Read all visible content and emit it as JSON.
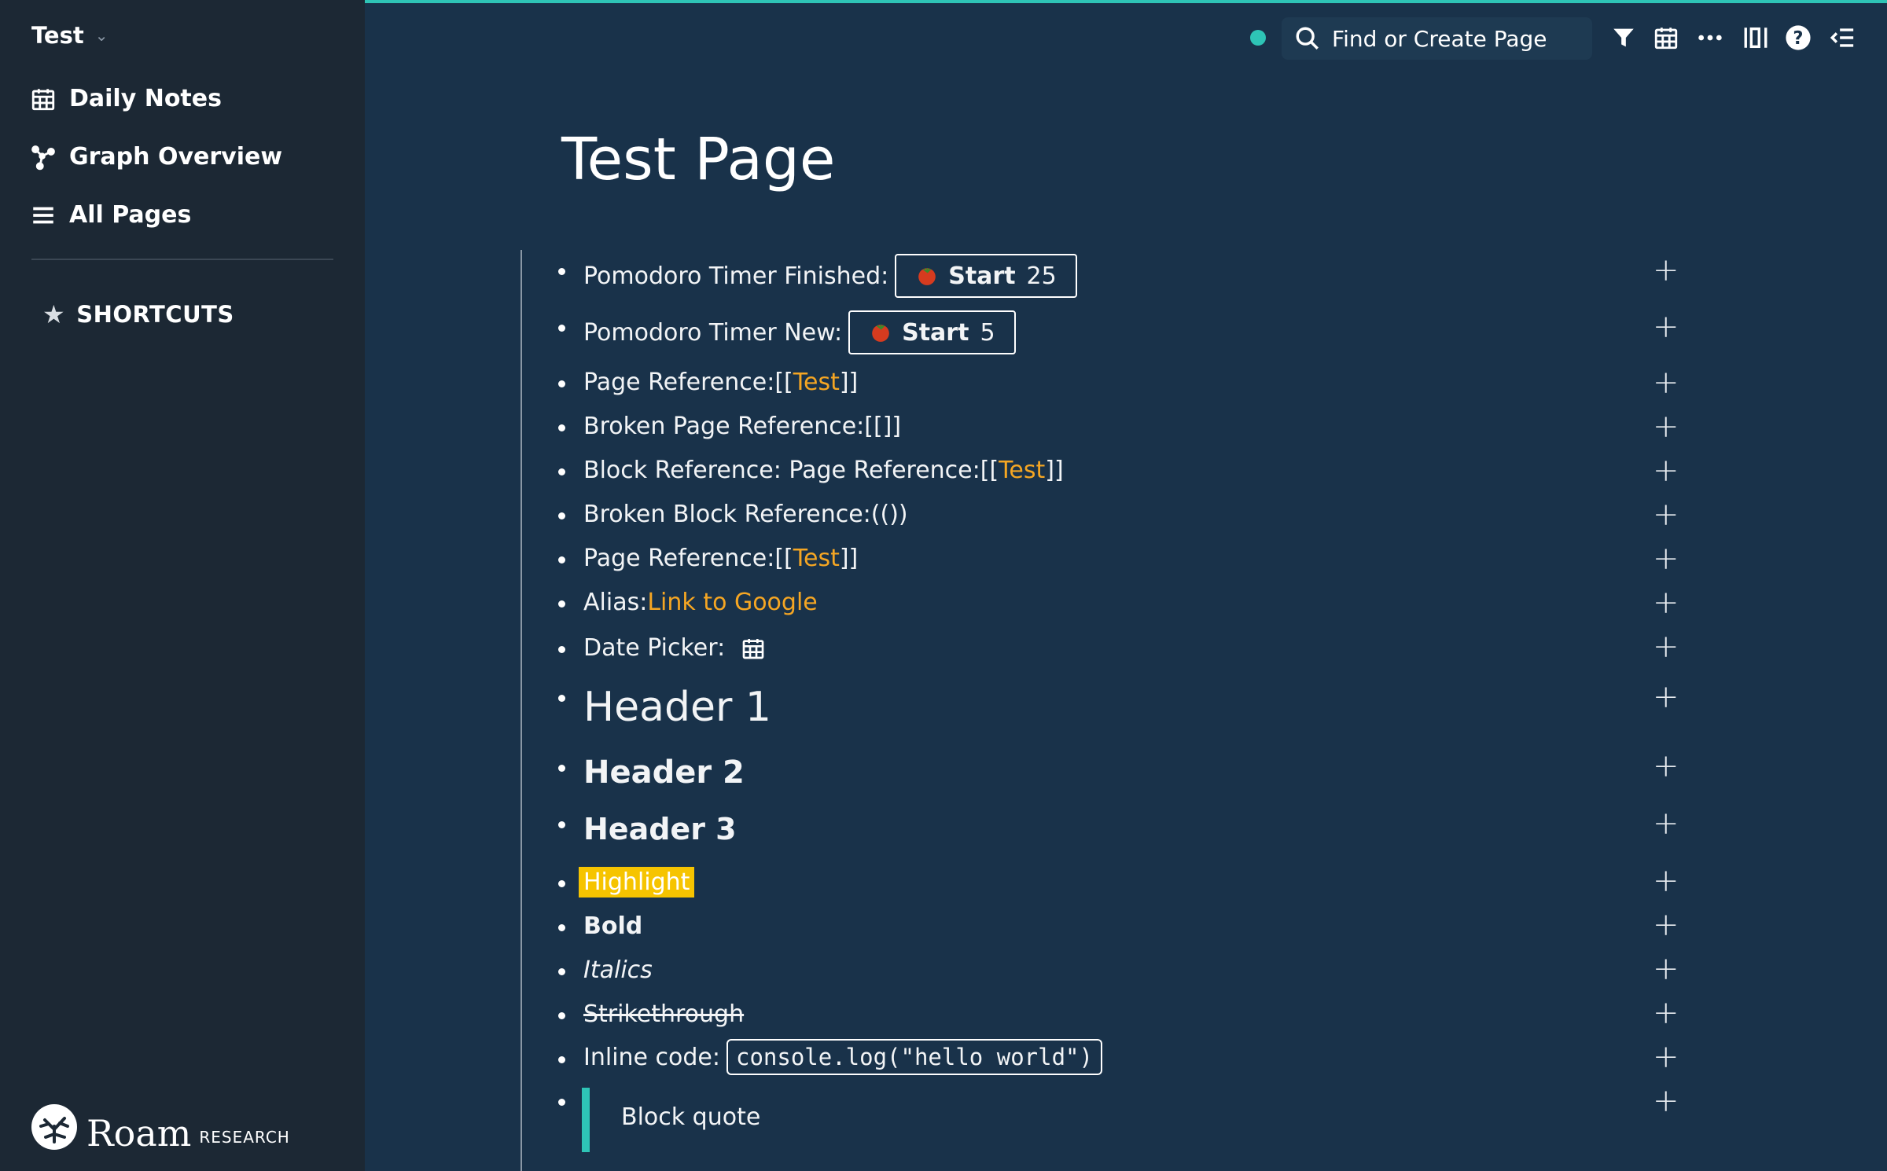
{
  "sidebar": {
    "graph_name": "Test",
    "nav": [
      {
        "label": "Daily Notes",
        "icon": "calendar-icon"
      },
      {
        "label": "Graph Overview",
        "icon": "graph-icon"
      },
      {
        "label": "All Pages",
        "icon": "list-icon"
      }
    ],
    "shortcuts_label": "SHORTCUTS",
    "logo": {
      "word": "Roam",
      "sub": "RESEARCH"
    }
  },
  "topbar": {
    "search_placeholder": "Find or Create Page",
    "icons": [
      "filter-icon",
      "calendar-icon",
      "more-icon",
      "sidebar-toggle-icon",
      "help-icon",
      "right-sidebar-icon"
    ]
  },
  "page": {
    "title": "Test Page",
    "blocks": {
      "pomo_finished": {
        "label": "Pomodoro Timer Finished:",
        "start": "Start",
        "minutes": "25"
      },
      "pomo_new": {
        "label": "Pomodoro Timer New:",
        "start": "Start",
        "minutes": "5"
      },
      "page_ref_1": {
        "label": "Page Reference: ",
        "open": "[[",
        "ref": "Test",
        "close": "]]"
      },
      "broken_page_ref": {
        "label": "Broken Page Reference: ",
        "value": "[[]]"
      },
      "block_ref": {
        "label": "Block Reference: Page Reference: ",
        "open": "[[",
        "ref": "Test",
        "close": "]]"
      },
      "broken_block_ref": {
        "label": "Broken Block Reference: ",
        "value": "(())"
      },
      "page_ref_2": {
        "label": "Page Reference: ",
        "open": "[[",
        "ref": "Test",
        "close": "]]"
      },
      "alias": {
        "label": "Alias: ",
        "link": "Link to Google"
      },
      "date_picker": {
        "label": "Date Picker:"
      },
      "header1": "Header 1",
      "header2": "Header 2",
      "header3": "Header 3",
      "highlight": "Highlight",
      "bold": "Bold",
      "italics": "Italics",
      "strikethrough": "Strikethrough",
      "inline_code": {
        "label": "Inline code: ",
        "code": "console.log(\"hello world\")"
      },
      "block_quote": "Block quote"
    }
  },
  "colors": {
    "accent": "#2ec4b6",
    "link": "#f5a623",
    "highlight": "#f6c400",
    "main_bg": "#19324a",
    "sidebar_bg": "#1c2834"
  }
}
